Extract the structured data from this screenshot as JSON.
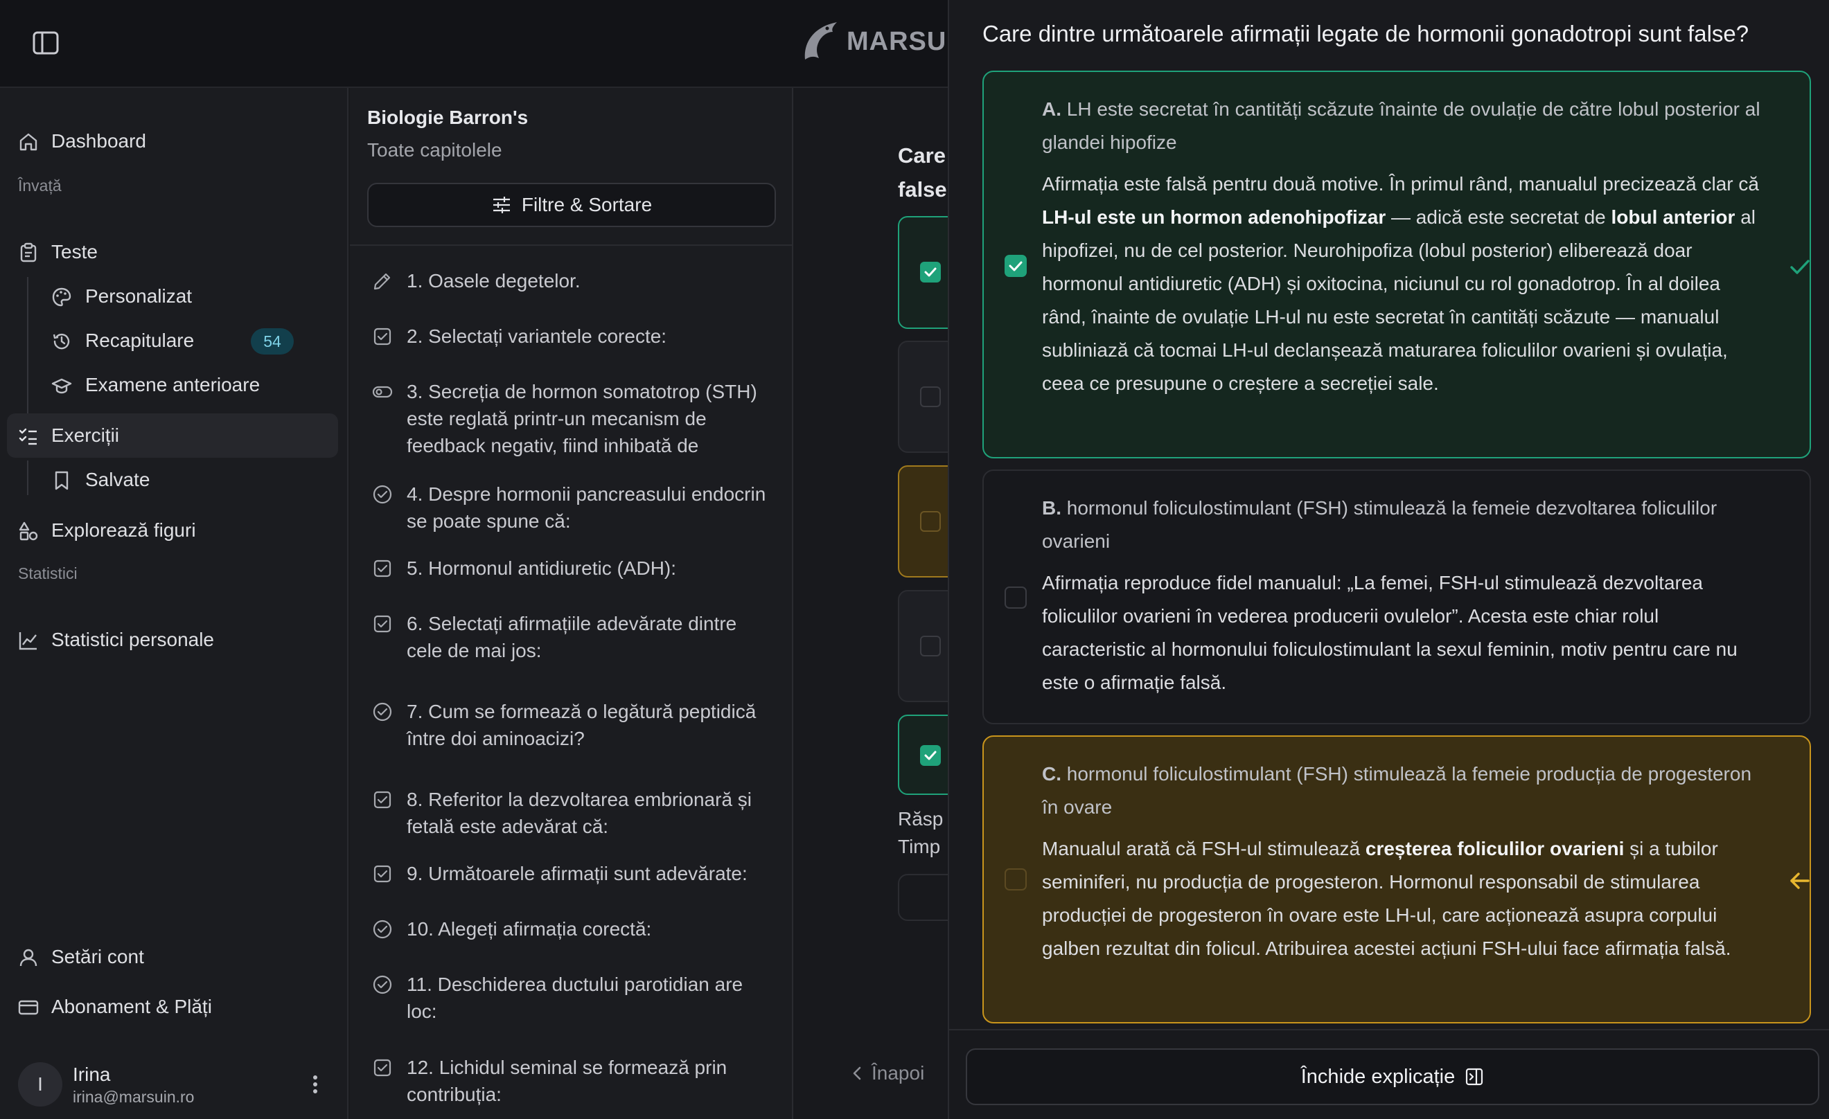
{
  "brand": {
    "name": "MARSUIN"
  },
  "sidebar": {
    "items": [
      {
        "label": "Dashboard",
        "icon": "home-icon"
      },
      {
        "label": "Teste",
        "icon": "clipboard-icon"
      },
      {
        "label": "Personalizat",
        "icon": "palette-icon"
      },
      {
        "label": "Recapitulare",
        "icon": "history-icon",
        "badge": "54"
      },
      {
        "label": "Examene anterioare",
        "icon": "graduation-cap-icon"
      },
      {
        "label": "Exerciții",
        "icon": "list-checks-icon",
        "active": true
      },
      {
        "label": "Salvate",
        "icon": "bookmark-icon"
      },
      {
        "label": "Explorează figuri",
        "icon": "shapes-icon"
      },
      {
        "label": "Statistici personale",
        "icon": "line-chart-icon"
      },
      {
        "label": "Setări cont",
        "icon": "user-icon"
      },
      {
        "label": "Abonament & Plăți",
        "icon": "credit-card-icon"
      }
    ],
    "sections": {
      "learn": "Învață",
      "stats": "Statistici"
    },
    "user": {
      "initial": "I",
      "name": "Irina",
      "email": "irina@marsuin.ro"
    }
  },
  "question_list": {
    "title": "Biologie Barron's",
    "subtitle": "Toate capitolele",
    "filter_label": "Filtre & Sortare",
    "items": [
      {
        "text": "1. Oasele degetelor.",
        "icon": "pencil-icon"
      },
      {
        "text": "2. Selectați variantele corecte:",
        "icon": "check-square-icon"
      },
      {
        "text": "3. Secreția de hormon somatotrop (STH) este reglată printr-un mecanism de feedback negativ, fiind inhibată de",
        "icon": "toggle-icon"
      },
      {
        "text": "4. Despre hormonii pancreasului endocrin se poate spune că:",
        "icon": "check-circle-icon"
      },
      {
        "text": "5. Hormonul antidiuretic (ADH):",
        "icon": "check-square-icon"
      },
      {
        "text": "6. Selectați afirmațiile adevărate dintre cele de mai jos:",
        "icon": "check-square-icon"
      },
      {
        "text": "7. Cum se formează o legătură peptidică între doi aminoacizi?",
        "icon": "check-circle-icon"
      },
      {
        "text": "8. Referitor la dezvoltarea embrionară și fetală este adevărat că:",
        "icon": "check-square-icon"
      },
      {
        "text": "9. Următoarele afirmații sunt adevărate:",
        "icon": "check-square-icon"
      },
      {
        "text": "10. Alegeți afirmația corectă:",
        "icon": "check-circle-icon"
      },
      {
        "text": "11. Deschiderea ductului parotidian are loc:",
        "icon": "check-circle-icon"
      },
      {
        "text": "12. Lichidul seminal se formează prin contribuția:",
        "icon": "check-square-icon"
      }
    ]
  },
  "main": {
    "question_partial": [
      "Care",
      "false"
    ],
    "labels_partial": [
      "Răsp",
      "Timp"
    ],
    "back_label": "Înapoi"
  },
  "explanation": {
    "question": "Care dintre următoarele afirmații legate de hormonii gonadotropi sunt false?",
    "options": [
      {
        "letter": "A.",
        "statement": "LH este secretat în cantități scăzute înainte de ovulație de către lobul posterior al glandei hipofize",
        "checked": true,
        "status": "correct",
        "parts": [
          {
            "t": "Afirmația este falsă pentru două motive. În primul rând, manualul precizează clar că "
          },
          {
            "t": "LH-ul este un hormon adenohipofizar",
            "b": true
          },
          {
            "t": " — adică este secretat de "
          },
          {
            "t": "lobul anterior",
            "b": true
          },
          {
            "t": " al hipofizei, nu de cel posterior. Neurohipofiza (lobul posterior) eliberează doar hormonul antidiuretic (ADH) și oxitocina, niciunul cu rol gonadotrop. În al doilea rând, înainte de ovulație LH-ul nu este secretat în cantități scăzute — manualul subliniază că tocmai LH-ul declanșează maturarea foliculilor ovarieni și ovulația, ceea ce presupune o creștere a secreției sale."
          }
        ]
      },
      {
        "letter": "B.",
        "statement": "hormonul foliculostimulant (FSH) stimulează la femeie dezvoltarea foliculilor ovarieni",
        "checked": false,
        "status": "neutral",
        "parts": [
          {
            "t": "Afirmația reproduce fidel manualul: „La femei, FSH-ul stimulează dezvoltarea foliculilor ovarieni în vederea producerii ovulelor”. Acesta este chiar rolul caracteristic al hormonului foliculostimulant la sexul feminin, motiv pentru care nu este o afirmație falsă."
          }
        ]
      },
      {
        "letter": "C.",
        "statement": "hormonul foliculostimulant (FSH) stimulează la femeie producția de progesteron în ovare",
        "checked": false,
        "status": "missed",
        "parts": [
          {
            "t": "Manualul arată că FSH-ul stimulează "
          },
          {
            "t": "creșterea foliculilor ovarieni",
            "b": true
          },
          {
            "t": " și a tubilor seminiferi, nu producția de progesteron. Hormonul responsabil de stimularea producției de progesteron în ovare este LH-ul, care acționează asupra corpului galben rezultat din folicul. Atribuirea acestei acțiuni FSH-ului face afirmația falsă."
          }
        ]
      }
    ],
    "close_label": "Închide explicație"
  },
  "colors": {
    "correct": "#1fa27a",
    "missed": "#e8b72f",
    "badge_bg": "#123f4c"
  }
}
